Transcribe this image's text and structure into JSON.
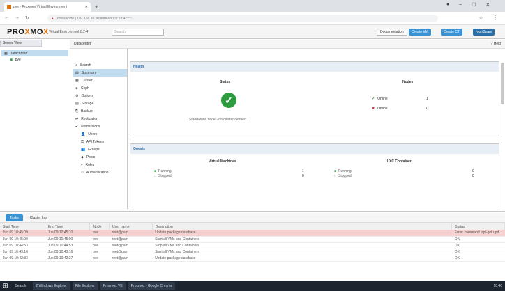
{
  "browser": {
    "tab_title": "pve - Proxmox Virtual Environment",
    "url": "Not secure | 192.168.10.50:8006/#v1:0:18:4:::::::",
    "menu_glyph": "⋮"
  },
  "header": {
    "logo_a": "PRO",
    "logo_b": "X",
    "logo_c": "MO",
    "logo_d": "X",
    "version": "Virtual Environment 6.2-4",
    "search_placeholder": "Search",
    "doc_label": "Documentation",
    "create_vm": "Create VM",
    "create_ct": "Create CT",
    "user": "root@pam"
  },
  "sidebar": {
    "view": "Server View",
    "datacenter": "Datacenter",
    "node": "pve"
  },
  "content_header": {
    "title": "Datacenter",
    "help": "Help"
  },
  "nav": [
    {
      "label": "Search",
      "sub": false,
      "active": false
    },
    {
      "label": "Summary",
      "sub": false,
      "active": true
    },
    {
      "label": "Cluster",
      "sub": false,
      "active": false
    },
    {
      "label": "Ceph",
      "sub": false,
      "active": false
    },
    {
      "label": "Options",
      "sub": false,
      "active": false
    },
    {
      "label": "Storage",
      "sub": false,
      "active": false
    },
    {
      "label": "Backup",
      "sub": false,
      "active": false
    },
    {
      "label": "Replication",
      "sub": false,
      "active": false
    },
    {
      "label": "Permissions",
      "sub": false,
      "active": false
    },
    {
      "label": "Users",
      "sub": true,
      "active": false
    },
    {
      "label": "API Tokens",
      "sub": true,
      "active": false
    },
    {
      "label": "Groups",
      "sub": true,
      "active": false
    },
    {
      "label": "Pools",
      "sub": true,
      "active": false
    },
    {
      "label": "Roles",
      "sub": true,
      "active": false
    },
    {
      "label": "Authentication",
      "sub": true,
      "active": false
    }
  ],
  "health": {
    "title": "Health",
    "status_label": "Status",
    "status_msg": "Standalone node - no cluster defined",
    "nodes_label": "Nodes",
    "online_label": "Online",
    "online_count": "1",
    "offline_label": "Offline",
    "offline_count": "0"
  },
  "guests": {
    "title": "Guests",
    "vm_title": "Virtual Machines",
    "vm_running": "Running",
    "vm_stopped": "Stopped",
    "vm_running_count": "1",
    "vm_stopped_count": "0",
    "ct_title": "LXC Container",
    "ct_running": "Running",
    "ct_stopped": "Stopped",
    "ct_running_count": "0",
    "ct_stopped_count": "0"
  },
  "bottom": {
    "tabs": [
      "Tasks",
      "Cluster log"
    ],
    "columns": [
      "Start Time",
      "End Time",
      "Node",
      "User name",
      "Description",
      "Status"
    ],
    "rows": [
      {
        "start": "Jun 09 10:45:09",
        "end": "Jun 09 10:45:10",
        "node": "pve",
        "user": "root@pam",
        "desc": "Update package database",
        "status": "Error: command 'apt-get upd...",
        "error": true
      },
      {
        "start": "Jun 09 10:45:00",
        "end": "Jun 09 10:45:00",
        "node": "pve",
        "user": "root@pam",
        "desc": "Start all VMs and Containers",
        "status": "OK",
        "error": false
      },
      {
        "start": "Jun 09 10:44:53",
        "end": "Jun 09 10:44:53",
        "node": "pve",
        "user": "root@pam",
        "desc": "Stop all VMs and Containers",
        "status": "OK",
        "error": false
      },
      {
        "start": "Jun 09 10:43:16",
        "end": "Jun 09 10:43:16",
        "node": "pve",
        "user": "root@pam",
        "desc": "Start all VMs and Containers",
        "status": "OK",
        "error": false
      },
      {
        "start": "Jun 09 10:42:33",
        "end": "Jun 09 10:42:37",
        "node": "pve",
        "user": "root@pam",
        "desc": "Update package database",
        "status": "OK",
        "error": false
      }
    ]
  },
  "taskbar": {
    "start": "⊞",
    "search": "Search",
    "items": [
      "2 Windows Explorer",
      "File Explorer",
      "Proxmox VE",
      "Proxmox - Google Chrome"
    ],
    "time": "10:46"
  },
  "colors": {
    "accent": "#3892d4",
    "ok": "#2e9b3e",
    "error": "#f5d0d0"
  }
}
